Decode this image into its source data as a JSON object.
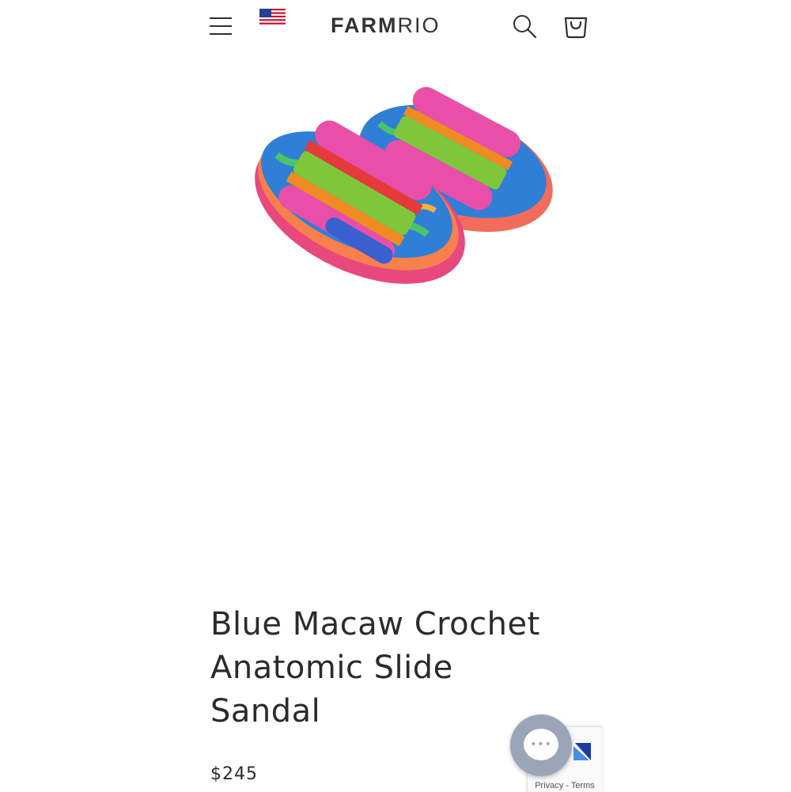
{
  "header": {
    "brand_bold": "FARM",
    "brand_light": "RIO",
    "menu_icon": "hamburger-menu-icon",
    "flag_icon": "us-flag-icon",
    "search_icon": "search-icon",
    "cart_icon": "shopping-bag-icon"
  },
  "product": {
    "title_line1": "Blue Macaw Crochet",
    "title_line2": "Anatomic Slide",
    "title_line3": "Sandal",
    "price": "$245",
    "image_icon": "crochet-slide-sandals-image"
  },
  "recaptcha": {
    "privacy": "Privacy",
    "separator": " - ",
    "terms": "Terms"
  },
  "chat": {
    "dots": "•••",
    "icon": "chat-bubble-icon"
  },
  "colors": {
    "text": "#2b2b2b",
    "chat_bg": "#9aa6b8"
  }
}
